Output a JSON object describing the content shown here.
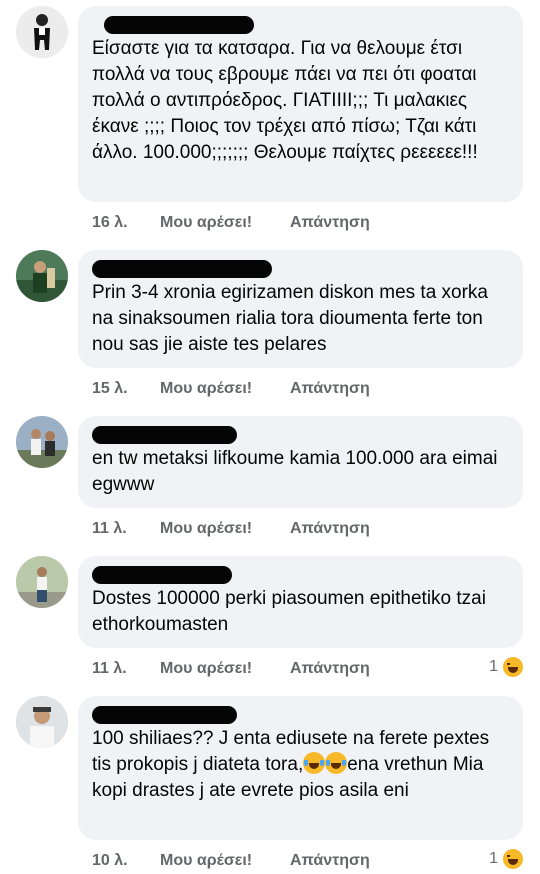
{
  "comments": [
    {
      "name": "",
      "text": "Είσαστε για τα κατσαρα. Για να θελουμε έτσι πολλά να τους εβρουμε πάει να πει ότι φοαται πολλά ο αντιπρόεδρος. ΓΙΑΤΙΙΙΙ;;; Τι μαλακιες έκανε ;;;; Ποιος τον τρέχει από πίσω; Τζαι κάτι άλλο. 100.000;;;;;;; Θελουμε παίχτες ρεεεεεε!!!",
      "time": "16 λ.",
      "like": "Μου αρέσει!",
      "reply": "Απάντηση",
      "reactions": ""
    },
    {
      "name": "",
      "text": "Prin 3-4 xronia egirizamen diskon mes ta xorka na sinaksoumen rialia tora dioumenta ferte ton nou sas jie aiste tes pelares",
      "time": "15 λ.",
      "like": "Μου αρέσει!",
      "reply": "Απάντηση",
      "reactions": ""
    },
    {
      "name": "",
      "text": "en tw metaksi lifkoume kamia 100.000 ara eimai egwww",
      "time": "11 λ.",
      "like": "Μου αρέσει!",
      "reply": "Απάντηση",
      "reactions": ""
    },
    {
      "name": "",
      "text": "Dostes 100000 perki piasoumen epithetiko tzai ethorkoumasten",
      "time": "11 λ.",
      "like": "Μου αρέσει!",
      "reply": "Απάντηση",
      "reactions": "1"
    },
    {
      "name": "",
      "text_part1": "100 shiliaes?? J enta ediusete na ferete pextes tis prokopis j diateta tora,",
      "text_part2": "ena vrethun Mia kopi drastes j ate evrete pios asila eni",
      "time": "10 λ.",
      "like": "Μου αρέσει!",
      "reply": "Απάντηση",
      "reactions": "1"
    }
  ],
  "icons": {
    "reaction": "laughing-face-icon",
    "inline_emoji": "tears-of-joy-emoji"
  },
  "colors": {
    "bubble": "#f0f2f5",
    "meta_text": "#65676b",
    "text": "#050505"
  }
}
